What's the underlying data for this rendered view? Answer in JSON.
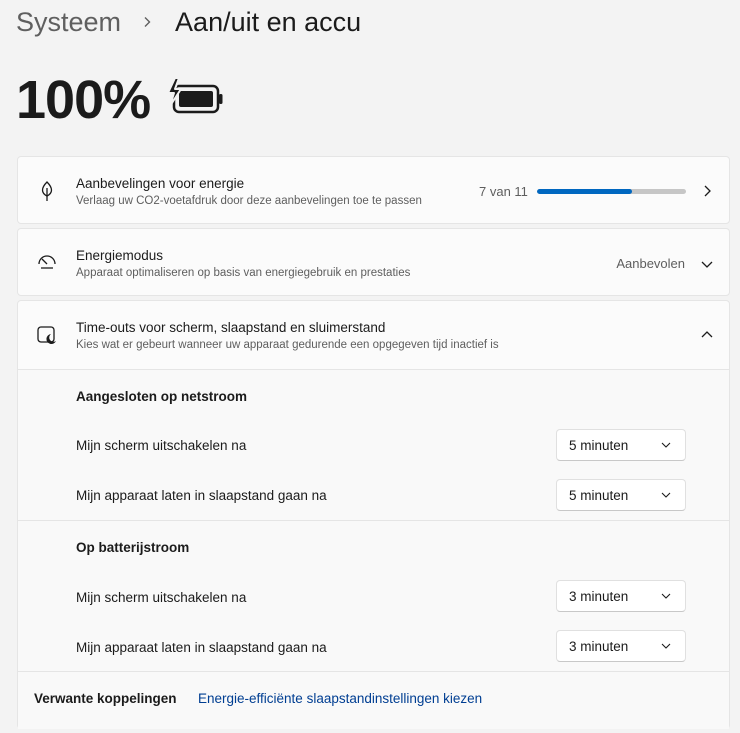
{
  "breadcrumb": {
    "parent": "Systeem",
    "current": "Aan/uit en accu"
  },
  "battery": {
    "percentage": "100%",
    "icon": "battery-charging-icon",
    "level": 1.0
  },
  "recommendations": {
    "title": "Aanbevelingen voor energie",
    "subtitle": "Verlaag uw CO2-voetafdruk door deze aanbevelingen toe te passen",
    "progress_label": "7 van 11",
    "progress_done": 7,
    "progress_total": 11,
    "icon": "leaf-icon"
  },
  "power_mode": {
    "title": "Energiemodus",
    "subtitle": "Apparaat optimaliseren op basis van energiegebruik en prestaties",
    "value": "Aanbevolen",
    "icon": "speedometer-icon"
  },
  "timeouts": {
    "title": "Time-outs voor scherm, slaapstand en sluimerstand",
    "subtitle": "Kies wat er gebeurt wanneer uw apparaat gedurende een opgegeven tijd inactief is",
    "icon": "screen-sleep-icon",
    "plugged_in": {
      "heading": "Aangesloten op netstroom",
      "screen_label": "Mijn scherm uitschakelen na",
      "screen_value": "5 minuten",
      "sleep_label": "Mijn apparaat laten in slaapstand gaan na",
      "sleep_value": "5 minuten"
    },
    "battery": {
      "heading": "Op batterijstroom",
      "screen_label": "Mijn scherm uitschakelen na",
      "screen_value": "3 minuten",
      "sleep_label": "Mijn apparaat laten in slaapstand gaan na",
      "sleep_value": "3 minuten"
    }
  },
  "related": {
    "label": "Verwante koppelingen",
    "link": "Energie-efficiënte slaapstandinstellingen kiezen"
  },
  "colors": {
    "accent": "#0067c0",
    "link": "#003e92"
  }
}
